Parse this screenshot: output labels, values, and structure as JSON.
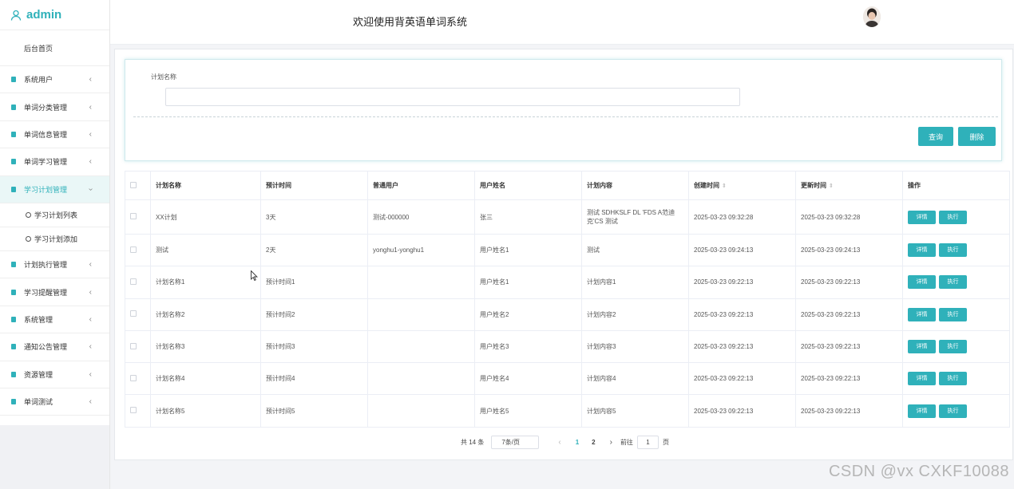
{
  "brand": {
    "name": "admin",
    "icon": "user-icon"
  },
  "header": {
    "title": "欢迎使用背英语单词系统"
  },
  "sidebar": {
    "home": "后台首页",
    "items_before": [
      {
        "label": "系统用户"
      },
      {
        "label": "单词分类管理"
      },
      {
        "label": "单词信息管理"
      },
      {
        "label": "单词学习管理"
      }
    ],
    "active": {
      "label": "学习计划管理",
      "subitems": [
        "学习计划列表",
        "学习计划添加"
      ]
    },
    "items_after": [
      {
        "label": "计划执行管理"
      },
      {
        "label": "学习提醒管理"
      },
      {
        "label": "系统管理"
      },
      {
        "label": "通知公告管理"
      },
      {
        "label": "资源管理"
      },
      {
        "label": "单词测试"
      },
      {
        "label": ""
      }
    ]
  },
  "search": {
    "label": "计划名称",
    "value": "",
    "query_button": "查询",
    "delete_button": "删除"
  },
  "table": {
    "columns": [
      "计划名称",
      "预计时间",
      "普通用户",
      "用户姓名",
      "计划内容",
      "创建时间",
      "更新时间",
      "操作"
    ],
    "detail_label": "详情",
    "exec_label": "执行",
    "rows": [
      {
        "name": "XX计划",
        "time": "3天",
        "user": "测试-000000",
        "username": "张三",
        "content": "测试 SDHKSLF DL 'FDS A范迪克'CS 测试",
        "created": "2025-03-23 09:32:28",
        "updated": "2025-03-23 09:32:28"
      },
      {
        "name": "测试",
        "time": "2天",
        "user": "yonghu1-yonghu1",
        "username": "用户姓名1",
        "content": "测试",
        "created": "2025-03-23 09:24:13",
        "updated": "2025-03-23 09:24:13"
      },
      {
        "name": "计划名称1",
        "time": "预计时间1",
        "user": "",
        "username": "用户姓名1",
        "content": "计划内容1",
        "created": "2025-03-23 09:22:13",
        "updated": "2025-03-23 09:22:13"
      },
      {
        "name": "计划名称2",
        "time": "预计时间2",
        "user": "",
        "username": "用户姓名2",
        "content": "计划内容2",
        "created": "2025-03-23 09:22:13",
        "updated": "2025-03-23 09:22:13"
      },
      {
        "name": "计划名称3",
        "time": "预计时间3",
        "user": "",
        "username": "用户姓名3",
        "content": "计划内容3",
        "created": "2025-03-23 09:22:13",
        "updated": "2025-03-23 09:22:13"
      },
      {
        "name": "计划名称4",
        "time": "预计时间4",
        "user": "",
        "username": "用户姓名4",
        "content": "计划内容4",
        "created": "2025-03-23 09:22:13",
        "updated": "2025-03-23 09:22:13"
      },
      {
        "name": "计划名称5",
        "time": "预计时间5",
        "user": "",
        "username": "用户姓名5",
        "content": "计划内容5",
        "created": "2025-03-23 09:22:13",
        "updated": "2025-03-23 09:22:13"
      }
    ]
  },
  "pagination": {
    "total": "共 14 条",
    "page_size": "7条/页",
    "pages": [
      "1",
      "2"
    ],
    "current": "1",
    "goto_label": "前往",
    "goto_value": "1",
    "page_suffix": "页"
  },
  "watermark": "CSDN @vx  CXKF10088",
  "colors": {
    "accent": "#2fb1ba",
    "background": "#f3f4f7"
  }
}
